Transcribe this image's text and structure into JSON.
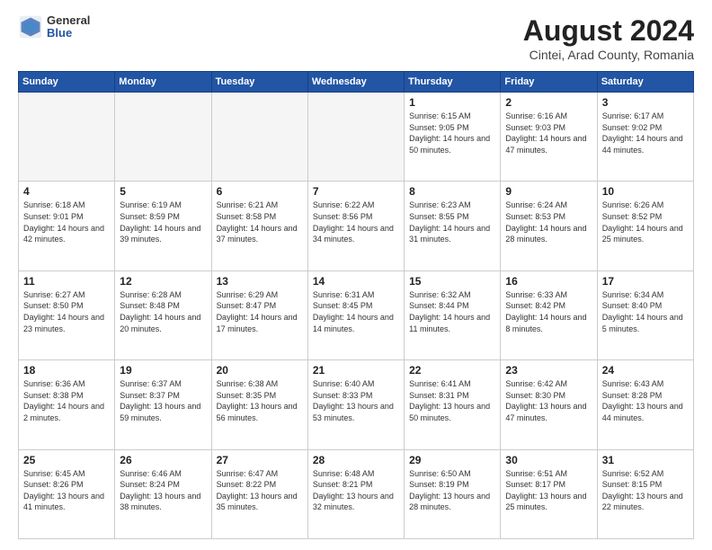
{
  "header": {
    "logo_general": "General",
    "logo_blue": "Blue",
    "main_title": "August 2024",
    "subtitle": "Cintei, Arad County, Romania"
  },
  "weekdays": [
    "Sunday",
    "Monday",
    "Tuesday",
    "Wednesday",
    "Thursday",
    "Friday",
    "Saturday"
  ],
  "weeks": [
    [
      {
        "day": "",
        "info": ""
      },
      {
        "day": "",
        "info": ""
      },
      {
        "day": "",
        "info": ""
      },
      {
        "day": "",
        "info": ""
      },
      {
        "day": "1",
        "info": "Sunrise: 6:15 AM\nSunset: 9:05 PM\nDaylight: 14 hours and 50 minutes."
      },
      {
        "day": "2",
        "info": "Sunrise: 6:16 AM\nSunset: 9:03 PM\nDaylight: 14 hours and 47 minutes."
      },
      {
        "day": "3",
        "info": "Sunrise: 6:17 AM\nSunset: 9:02 PM\nDaylight: 14 hours and 44 minutes."
      }
    ],
    [
      {
        "day": "4",
        "info": "Sunrise: 6:18 AM\nSunset: 9:01 PM\nDaylight: 14 hours and 42 minutes."
      },
      {
        "day": "5",
        "info": "Sunrise: 6:19 AM\nSunset: 8:59 PM\nDaylight: 14 hours and 39 minutes."
      },
      {
        "day": "6",
        "info": "Sunrise: 6:21 AM\nSunset: 8:58 PM\nDaylight: 14 hours and 37 minutes."
      },
      {
        "day": "7",
        "info": "Sunrise: 6:22 AM\nSunset: 8:56 PM\nDaylight: 14 hours and 34 minutes."
      },
      {
        "day": "8",
        "info": "Sunrise: 6:23 AM\nSunset: 8:55 PM\nDaylight: 14 hours and 31 minutes."
      },
      {
        "day": "9",
        "info": "Sunrise: 6:24 AM\nSunset: 8:53 PM\nDaylight: 14 hours and 28 minutes."
      },
      {
        "day": "10",
        "info": "Sunrise: 6:26 AM\nSunset: 8:52 PM\nDaylight: 14 hours and 25 minutes."
      }
    ],
    [
      {
        "day": "11",
        "info": "Sunrise: 6:27 AM\nSunset: 8:50 PM\nDaylight: 14 hours and 23 minutes."
      },
      {
        "day": "12",
        "info": "Sunrise: 6:28 AM\nSunset: 8:48 PM\nDaylight: 14 hours and 20 minutes."
      },
      {
        "day": "13",
        "info": "Sunrise: 6:29 AM\nSunset: 8:47 PM\nDaylight: 14 hours and 17 minutes."
      },
      {
        "day": "14",
        "info": "Sunrise: 6:31 AM\nSunset: 8:45 PM\nDaylight: 14 hours and 14 minutes."
      },
      {
        "day": "15",
        "info": "Sunrise: 6:32 AM\nSunset: 8:44 PM\nDaylight: 14 hours and 11 minutes."
      },
      {
        "day": "16",
        "info": "Sunrise: 6:33 AM\nSunset: 8:42 PM\nDaylight: 14 hours and 8 minutes."
      },
      {
        "day": "17",
        "info": "Sunrise: 6:34 AM\nSunset: 8:40 PM\nDaylight: 14 hours and 5 minutes."
      }
    ],
    [
      {
        "day": "18",
        "info": "Sunrise: 6:36 AM\nSunset: 8:38 PM\nDaylight: 14 hours and 2 minutes."
      },
      {
        "day": "19",
        "info": "Sunrise: 6:37 AM\nSunset: 8:37 PM\nDaylight: 13 hours and 59 minutes."
      },
      {
        "day": "20",
        "info": "Sunrise: 6:38 AM\nSunset: 8:35 PM\nDaylight: 13 hours and 56 minutes."
      },
      {
        "day": "21",
        "info": "Sunrise: 6:40 AM\nSunset: 8:33 PM\nDaylight: 13 hours and 53 minutes."
      },
      {
        "day": "22",
        "info": "Sunrise: 6:41 AM\nSunset: 8:31 PM\nDaylight: 13 hours and 50 minutes."
      },
      {
        "day": "23",
        "info": "Sunrise: 6:42 AM\nSunset: 8:30 PM\nDaylight: 13 hours and 47 minutes."
      },
      {
        "day": "24",
        "info": "Sunrise: 6:43 AM\nSunset: 8:28 PM\nDaylight: 13 hours and 44 minutes."
      }
    ],
    [
      {
        "day": "25",
        "info": "Sunrise: 6:45 AM\nSunset: 8:26 PM\nDaylight: 13 hours and 41 minutes."
      },
      {
        "day": "26",
        "info": "Sunrise: 6:46 AM\nSunset: 8:24 PM\nDaylight: 13 hours and 38 minutes."
      },
      {
        "day": "27",
        "info": "Sunrise: 6:47 AM\nSunset: 8:22 PM\nDaylight: 13 hours and 35 minutes."
      },
      {
        "day": "28",
        "info": "Sunrise: 6:48 AM\nSunset: 8:21 PM\nDaylight: 13 hours and 32 minutes."
      },
      {
        "day": "29",
        "info": "Sunrise: 6:50 AM\nSunset: 8:19 PM\nDaylight: 13 hours and 28 minutes."
      },
      {
        "day": "30",
        "info": "Sunrise: 6:51 AM\nSunset: 8:17 PM\nDaylight: 13 hours and 25 minutes."
      },
      {
        "day": "31",
        "info": "Sunrise: 6:52 AM\nSunset: 8:15 PM\nDaylight: 13 hours and 22 minutes."
      }
    ]
  ]
}
